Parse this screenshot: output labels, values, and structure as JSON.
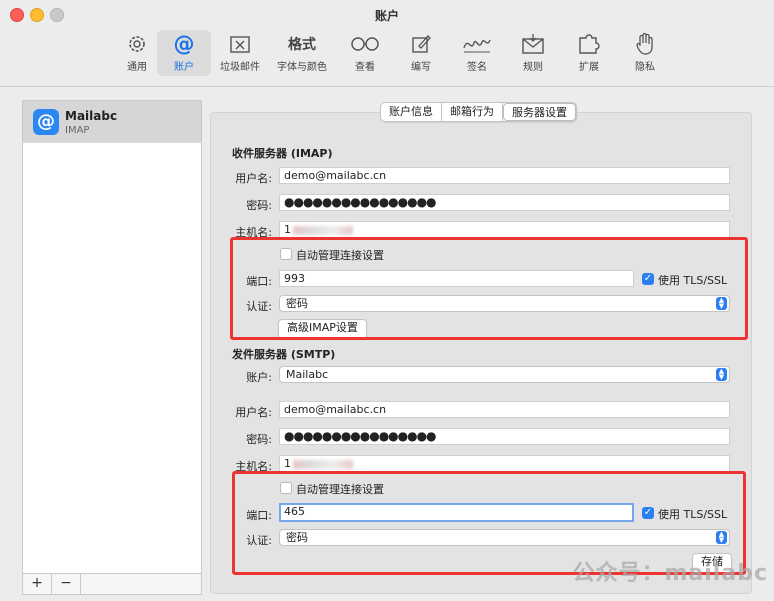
{
  "window": {
    "title": "账户"
  },
  "toolbar": {
    "items": [
      {
        "label": "通用",
        "icon": "gear-icon"
      },
      {
        "label": "账户",
        "icon": "at-icon",
        "active": true
      },
      {
        "label": "垃圾邮件",
        "icon": "junk-icon"
      },
      {
        "label": "字体与颜色",
        "icon": "fonts-icon",
        "text": "格式"
      },
      {
        "label": "查看",
        "icon": "glasses-icon"
      },
      {
        "label": "编写",
        "icon": "compose-icon"
      },
      {
        "label": "签名",
        "icon": "signature-icon"
      },
      {
        "label": "规则",
        "icon": "rules-icon"
      },
      {
        "label": "扩展",
        "icon": "puzzle-icon"
      },
      {
        "label": "隐私",
        "icon": "hand-icon"
      }
    ]
  },
  "sidebar": {
    "account": {
      "name": "Mailabc",
      "type": "IMAP",
      "icon": "@"
    },
    "add_label": "+",
    "remove_label": "−"
  },
  "tabs": [
    {
      "label": "账户信息"
    },
    {
      "label": "邮箱行为"
    },
    {
      "label": "服务器设置",
      "selected": true
    }
  ],
  "incoming": {
    "section_title": "收件服务器 (IMAP)",
    "username_label": "用户名:",
    "username": "demo@mailabc.cn",
    "password_label": "密码:",
    "password": "●●●●●●●●●●●●●●●●",
    "host_label": "主机名:",
    "host": "1",
    "auto_manage_label": "自动管理连接设置",
    "auto_manage": false,
    "port_label": "端口:",
    "port": "993",
    "tls_label": "使用 TLS/SSL",
    "tls": true,
    "auth_label": "认证:",
    "auth": "密码",
    "advanced_button": "高级IMAP设置"
  },
  "outgoing": {
    "section_title": "发件服务器 (SMTP)",
    "account_label": "账户:",
    "account": "Mailabc",
    "username_label": "用户名:",
    "username": "demo@mailabc.cn",
    "password_label": "密码:",
    "password": "●●●●●●●●●●●●●●●●",
    "host_label": "主机名:",
    "host": "1",
    "auto_manage_label": "自动管理连接设置",
    "auto_manage": false,
    "port_label": "端口:",
    "port": "465",
    "tls_label": "使用 TLS/SSL",
    "tls": true,
    "auth_label": "认证:",
    "auth": "密码",
    "save_button": "存储"
  },
  "watermark": "公众号：mailabc",
  "colors": {
    "accent": "#2b7ff0",
    "highlight_box": "#e33333"
  }
}
